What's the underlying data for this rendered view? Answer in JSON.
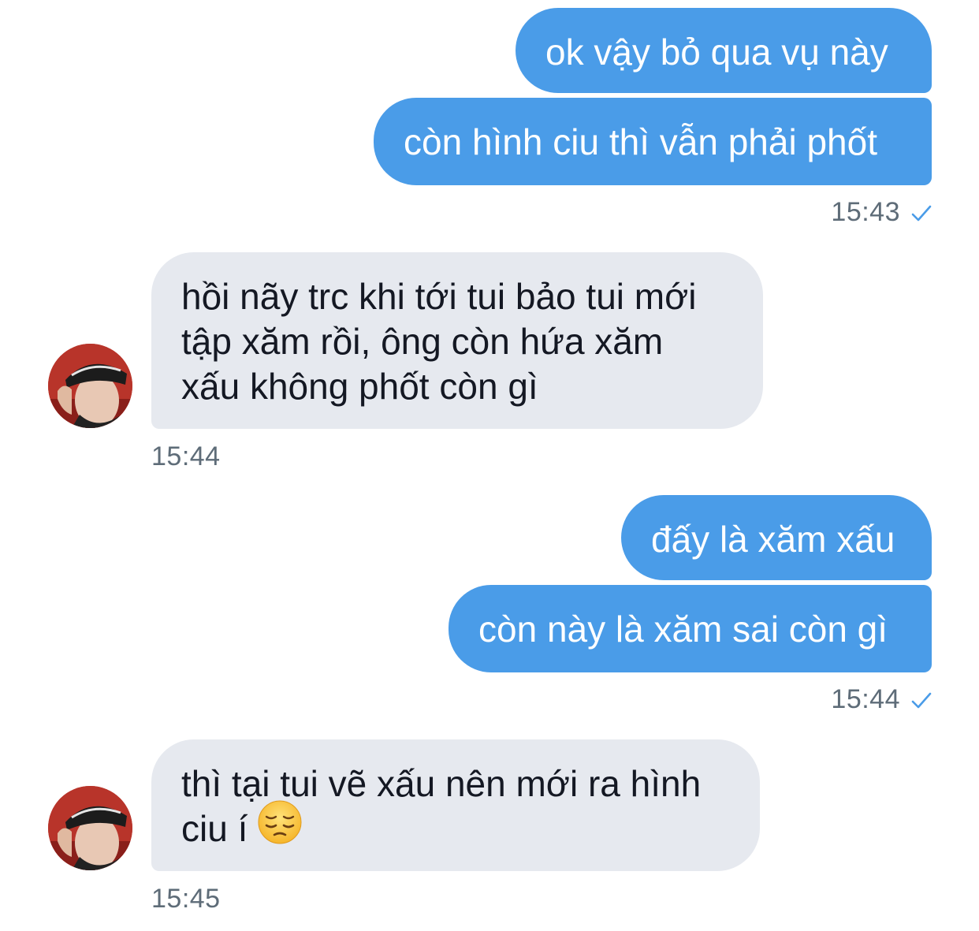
{
  "colors": {
    "outgoing_bubble": "#4a9ce8",
    "incoming_bubble": "#e6e9ef",
    "timestamp": "#5e6c78",
    "read_check": "#4a9ce8"
  },
  "messages": {
    "m1": {
      "text": "ok vậy bỏ qua vụ này"
    },
    "m2": {
      "text": "còn hình ciu thì vẫn phải phốt"
    },
    "t1": {
      "time": "15:43",
      "status_icon": "check-icon"
    },
    "m3": {
      "line1": "hồi nãy trc khi tới tui bảo tui mới",
      "line2": "tập xăm rồi, ông còn hứa xăm",
      "line3": "xấu không phốt còn gì"
    },
    "t2": {
      "time": "15:44"
    },
    "m4": {
      "text": "đấy là xăm xấu"
    },
    "m5": {
      "text": "còn này là xăm sai còn gì"
    },
    "t3": {
      "time": "15:44",
      "status_icon": "check-icon"
    },
    "m6": {
      "line1": "thì tại tui vẽ xấu nên mới ra hình",
      "line2": "ciu í",
      "emoji": "pensive-face-emoji"
    },
    "t4": {
      "time": "15:45"
    }
  }
}
